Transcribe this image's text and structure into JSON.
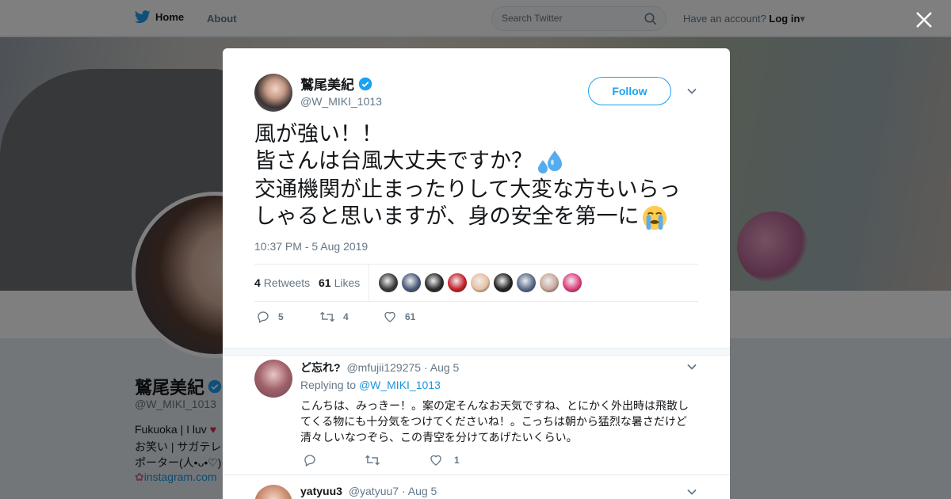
{
  "topbar": {
    "home_label": "Home",
    "about_label": "About",
    "search_placeholder": "Search Twitter",
    "account_prompt": "Have an account?",
    "login_label": "Log in"
  },
  "profile_bg": {
    "name": "鷲尾美紀",
    "handle": "@W_MIKI_1013",
    "bio_line1": "Fukuoka | I luv",
    "bio_line2": "お笑い | サガテレ",
    "bio_line3": "ポーター(人•ᴗ•♡)",
    "link": "instagram.com"
  },
  "tweet": {
    "author_name": "鷲尾美紀",
    "author_handle": "@W_MIKI_1013",
    "follow_label": "Follow",
    "text_lines": [
      "風が強い！！",
      "皆さんは台風大丈夫ですか？",
      "交通機関が止まったりして大変な方もいらっ",
      "しゃると思いますが、身の安全を第一に"
    ],
    "emojis": [
      "sweat-droplets-emoji",
      "loudly-crying-face-emoji"
    ],
    "timestamp": "10:37 PM - 5 Aug 2019",
    "retweets_count": "4",
    "retweets_label": "Retweets",
    "likes_count": "61",
    "likes_label": "Likes",
    "likers": [
      "#3a3a3a",
      "#4a5b7a",
      "#2b2b2b",
      "#c8202a",
      "#e8c0a0",
      "#222222",
      "#5a6a8a",
      "#c9a89a",
      "#e04080"
    ],
    "actions": {
      "reply_count": "5",
      "retweet_count": "4",
      "like_count": "61"
    }
  },
  "replies": [
    {
      "name": "ど忘れ?",
      "handle": "@mfujii129275",
      "date": "· Aug 5",
      "replying_prefix": "Replying to",
      "replying_to": "@W_MIKI_1013",
      "text": "こんちは、みっきー！。案の定そんなお天気ですね、とにかく外出時は飛散してくる物にも十分気をつけてくださいね！。こっちは朝から猛烈な暑さだけど清々しいなつぞら、この青空を分けてあげたいくらい。",
      "reply_count": "",
      "retweet_count": "",
      "like_count": "1",
      "avatar_color": "#a0606a"
    },
    {
      "name": "yatyuu3",
      "handle": "@yatyuu7",
      "date": "· Aug 5",
      "avatar_color": "#c98a70"
    }
  ],
  "colors": {
    "accent": "#1da1f2",
    "link": "#1b95e0",
    "verified": "#1da1f2"
  }
}
